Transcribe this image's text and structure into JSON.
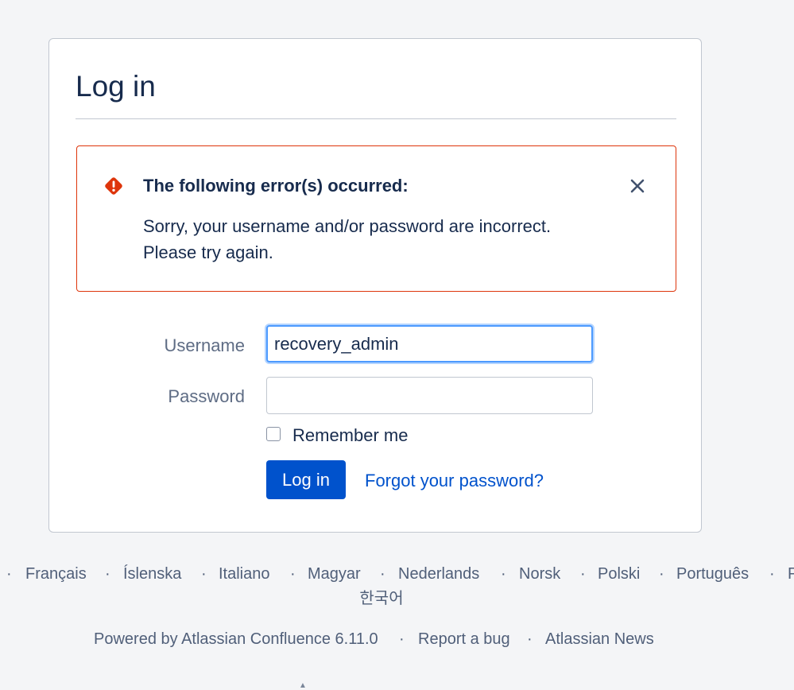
{
  "login": {
    "title": "Log in",
    "error": {
      "heading": "The following error(s) occurred:",
      "message_line1": "Sorry, your username and/or password are incorrect.",
      "message_line2": "Please try again.",
      "icon": "error-icon",
      "close_icon": "close-icon",
      "color": "#de350b"
    },
    "username_label": "Username",
    "username_value": "recovery_admin",
    "password_label": "Password",
    "password_value": "",
    "remember_label": "Remember me",
    "remember_checked": false,
    "submit_label": "Log in",
    "forgot_label": "Forgot your password?"
  },
  "footer": {
    "languages": [
      "Français",
      "Íslenska",
      "Italiano",
      "Magyar",
      "Nederlands",
      "Norsk",
      "Polski",
      "Português",
      "P"
    ],
    "korean": "한국어",
    "powered_by": "Powered by Atlassian Confluence 6.11.0",
    "report_bug": "Report a bug",
    "news": "Atlassian News",
    "separator": "·"
  },
  "colors": {
    "accent": "#0052cc",
    "focus": "#4c9aff",
    "error": "#de350b",
    "background": "#f4f5f7"
  }
}
